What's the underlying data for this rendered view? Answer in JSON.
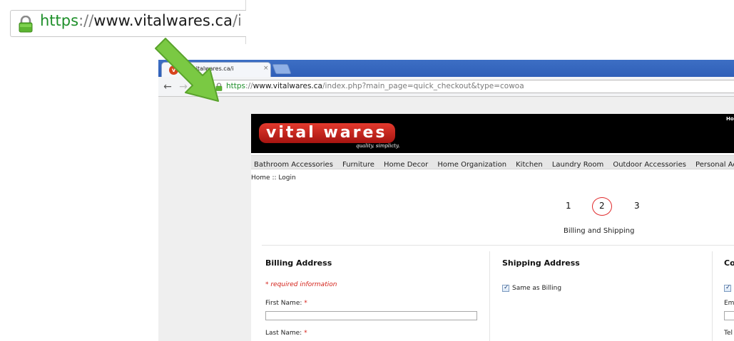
{
  "callout": {
    "lock_icon": "lock-icon",
    "url_scheme": "https",
    "url_sep": "://",
    "url_host": "www.vitalwares.ca",
    "url_tail": "/i"
  },
  "colors": {
    "secure_green": "#1e8f2a",
    "arrow_green": "#7ac943",
    "tab_strip_blue": "#3d6fc4",
    "brand_red": "#e33a2e",
    "required_red": "#d4221a"
  },
  "browser": {
    "tab": {
      "title": "ww.vitalwares.ca/i",
      "close_glyph": "×"
    },
    "nav": {
      "back_glyph": "←",
      "forward_glyph": "→",
      "reload_glyph": "C"
    },
    "address": {
      "scheme": "https",
      "sep": "://",
      "host": "www.vitalwares.ca",
      "path": "/index.php?main_page=quick_checkout&type=cowoa"
    }
  },
  "site": {
    "logo_text": "vital wares",
    "tagline": "quality. simplicty.",
    "header_link": "Ho",
    "categories": [
      "Bathroom Accessories",
      "Furniture",
      "Home Decor",
      "Home Organization",
      "Kitchen",
      "Laundry Room",
      "Outdoor Accessories",
      "Personal Acces"
    ],
    "breadcrumb": "Home :: Login"
  },
  "checkout": {
    "steps": [
      "1",
      "2",
      "3"
    ],
    "current_step_caption": "Billing and Shipping",
    "billing": {
      "title": "Billing Address",
      "required_note": "* required information",
      "first_name_label": "First Name:",
      "last_name_label": "Last Name:",
      "required_mark": "*"
    },
    "shipping": {
      "title": "Shipping Address",
      "same_as_billing_label": "Same as Billing",
      "same_as_billing_checked": true
    },
    "contact": {
      "title_partial": "Co",
      "email_label_partial": "Em",
      "telephone_label_partial": "Tel"
    }
  }
}
